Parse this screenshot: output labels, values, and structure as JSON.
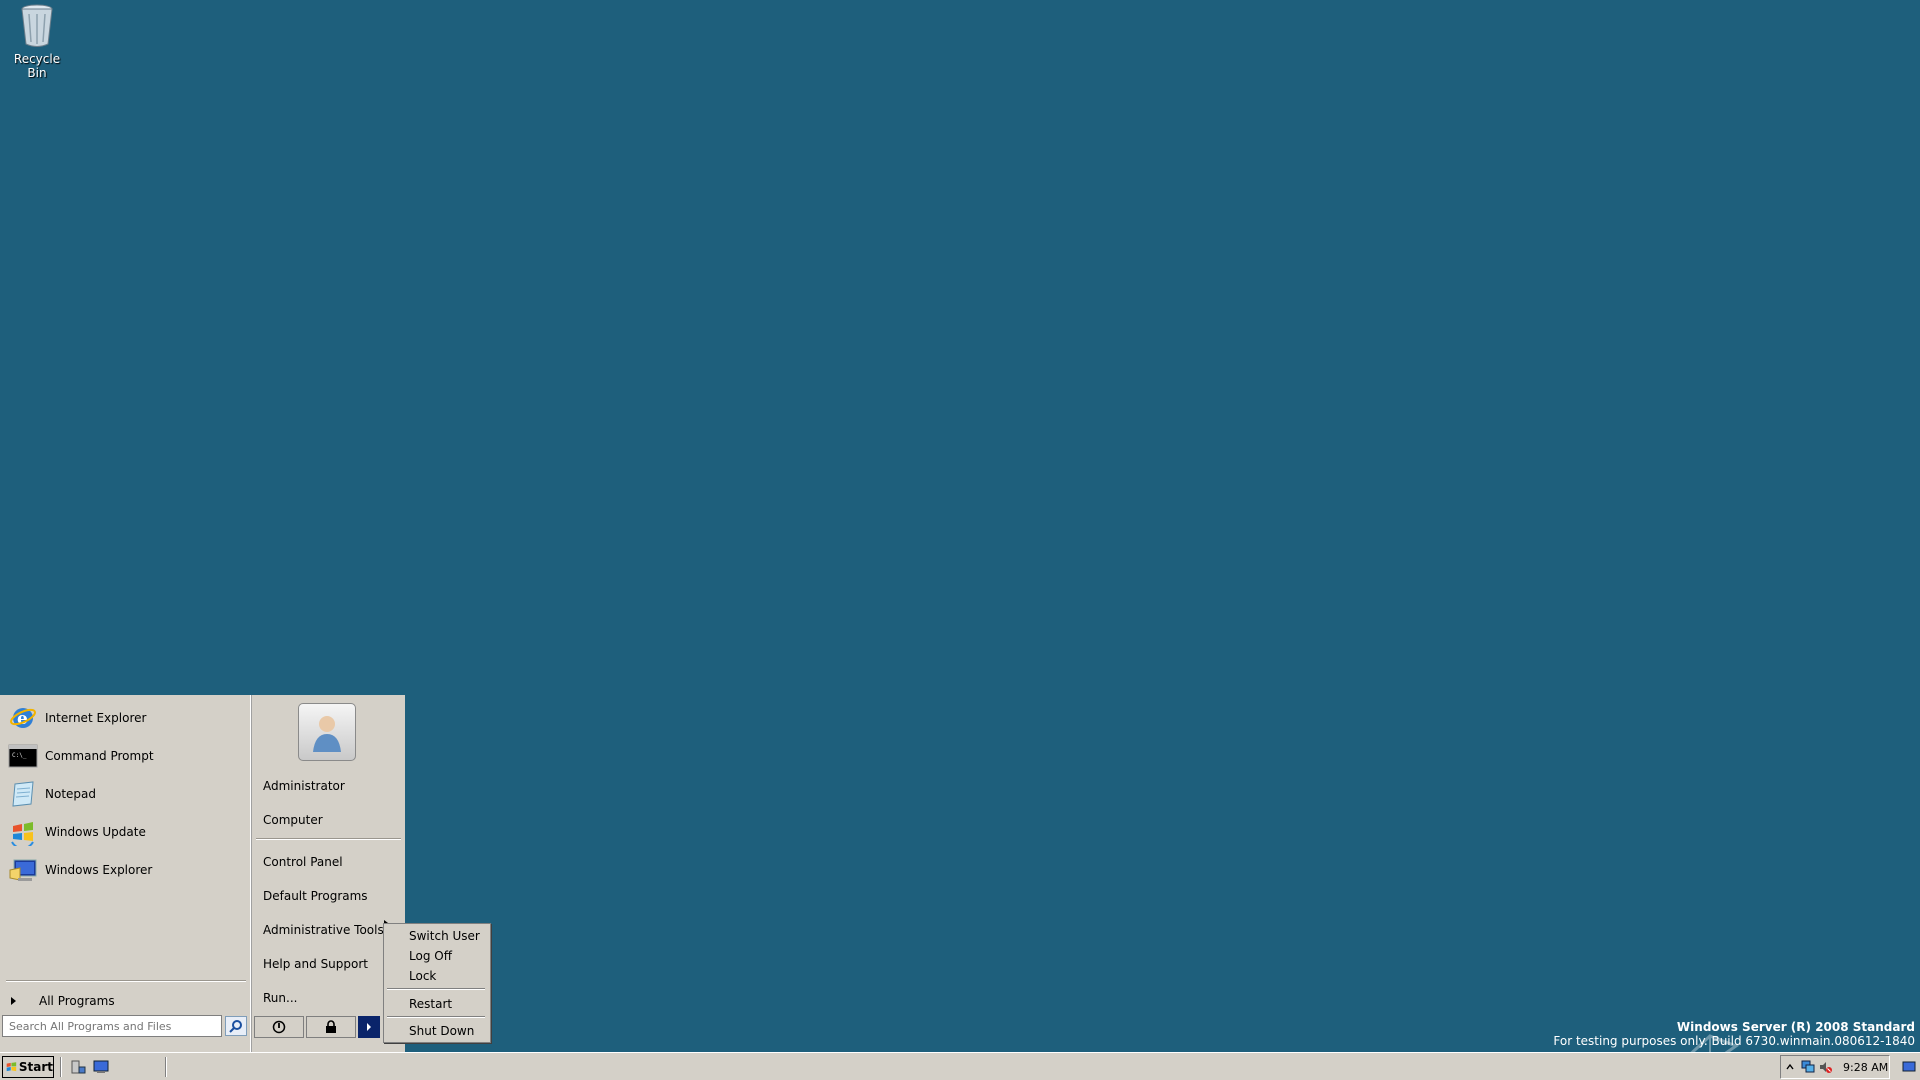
{
  "desktop": {
    "icons": [
      {
        "label": "Recycle Bin",
        "icon": "recycle-bin-icon"
      }
    ]
  },
  "start_menu": {
    "pinned": [
      {
        "label": "Internet Explorer",
        "icon": "internet-explorer-icon"
      },
      {
        "label": "Command Prompt",
        "icon": "command-prompt-icon"
      },
      {
        "label": "Notepad",
        "icon": "notepad-icon"
      },
      {
        "label": "Windows Update",
        "icon": "windows-update-icon"
      },
      {
        "label": "Windows Explorer",
        "icon": "windows-explorer-icon"
      }
    ],
    "all_programs": "All Programs",
    "search_placeholder": "Search All Programs and Files",
    "right_items": [
      {
        "label": "Administrator"
      },
      {
        "label": "Computer"
      },
      {
        "label": "Control Panel"
      },
      {
        "label": "Default Programs"
      },
      {
        "label": "Administrative Tools"
      },
      {
        "label": "Help and Support"
      },
      {
        "label": "Run..."
      }
    ]
  },
  "shutdown_menu": {
    "items": [
      "Switch User",
      "Log Off",
      "Lock",
      "Restart",
      "Shut Down"
    ]
  },
  "watermark": {
    "line1": "Windows Server (R) 2008 Standard",
    "line2": "For testing purposes only. Build 6730.winmain.080612-1840"
  },
  "taskbar": {
    "start_label": "Start",
    "clock": "9:28 AM"
  },
  "colors": {
    "desktop": "#1e5f7c",
    "menu": "#d4d0c8",
    "accent": "#0a246a"
  }
}
